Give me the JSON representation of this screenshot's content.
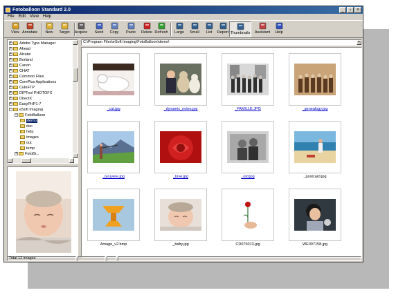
{
  "window": {
    "title": "Fotoballoon Standard 2.0"
  },
  "menu": [
    "File",
    "Edit",
    "View",
    "Help"
  ],
  "toolbar": [
    {
      "label": "View",
      "icon": "view-icon",
      "color": "#d8a020"
    },
    {
      "label": "Annotate",
      "icon": "annotate-icon",
      "color": "#c04020"
    },
    {
      "label": "New",
      "icon": "new-icon",
      "color": "#e0b030"
    },
    {
      "label": "Target",
      "icon": "target-icon",
      "color": "#e0b030"
    },
    {
      "label": "Acquire",
      "icon": "acquire-icon",
      "color": "#606060"
    },
    {
      "label": "Send",
      "icon": "send-icon",
      "color": "#4060c0"
    },
    {
      "label": "Copy",
      "icon": "copy-icon",
      "color": "#6080c0"
    },
    {
      "label": "Paste",
      "icon": "paste-icon",
      "color": "#6080c0"
    },
    {
      "label": "Delete",
      "icon": "delete-icon",
      "color": "#d02020"
    },
    {
      "label": "Refresh",
      "icon": "refresh-icon",
      "color": "#30a030"
    },
    {
      "label": "Large",
      "icon": "large-icons-icon",
      "color": "#306090"
    },
    {
      "label": "Small",
      "icon": "small-icons-icon",
      "color": "#306090"
    },
    {
      "label": "List",
      "icon": "list-icon",
      "color": "#306090"
    },
    {
      "label": "Report",
      "icon": "report-icon",
      "color": "#306090"
    },
    {
      "label": "Thumbnails",
      "icon": "thumbnails-icon",
      "color": "#306090",
      "pressed": true
    },
    {
      "label": "Assistant",
      "icon": "assistant-icon",
      "color": "#c04040"
    },
    {
      "label": "Help",
      "icon": "help-icon",
      "color": "#3050c0"
    }
  ],
  "tree": [
    {
      "label": "Adobe Type Manager",
      "level": 0,
      "expanded": false
    },
    {
      "label": "Ahead",
      "level": 0,
      "expanded": false
    },
    {
      "label": "Alcatel",
      "level": 0,
      "expanded": false
    },
    {
      "label": "Borland",
      "level": 0,
      "expanded": false
    },
    {
      "label": "Canon",
      "level": 0,
      "expanded": false
    },
    {
      "label": "CHAT",
      "level": 0,
      "expanded": false
    },
    {
      "label": "Common Files",
      "level": 0,
      "expanded": false
    },
    {
      "label": "ComPlus Applications",
      "level": 0,
      "expanded": false
    },
    {
      "label": "CuteFTP",
      "level": 0,
      "expanded": false
    },
    {
      "label": "DIPTool PHOTOFX",
      "level": 0,
      "expanded": false
    },
    {
      "label": "DirectX",
      "level": 0,
      "expanded": false
    },
    {
      "label": "EasyPHP1-7",
      "level": 0,
      "expanded": false
    },
    {
      "label": "eSoft Imaging",
      "level": 0,
      "expanded": true
    },
    {
      "label": "FotoBalloon",
      "level": 1,
      "expanded": true
    },
    {
      "label": "demo",
      "level": 2,
      "selected": true
    },
    {
      "label": "doc",
      "level": 2
    },
    {
      "label": "help",
      "level": 2
    },
    {
      "label": "images",
      "level": 2
    },
    {
      "label": "out",
      "level": 2
    },
    {
      "label": "temp",
      "level": 2
    },
    {
      "label": "FotoBi...",
      "level": 1,
      "expanded": false
    }
  ],
  "path": "C:\\Program Files\\eSoft Imaging\\FotoBalloon\\demo\\",
  "thumbnails": [
    {
      "caption": "_cat.jpg",
      "link": true,
      "scene": "cat"
    },
    {
      "caption": "_dynamic_notes.jpg",
      "link": true,
      "scene": "kids-teddies"
    },
    {
      "caption": "_FAMILLE.JPG",
      "link": true,
      "scene": "family-bw"
    },
    {
      "caption": "_genealogy.jpg",
      "link": true,
      "scene": "genealogy-sepia"
    },
    {
      "caption": "_Gruyere.jpg",
      "link": true,
      "scene": "gruyere"
    },
    {
      "caption": "_love.jpg",
      "link": true,
      "scene": "rose"
    },
    {
      "caption": "_old.jpg",
      "link": true,
      "scene": "old-couple"
    },
    {
      "caption": "_postcard.jpg",
      "link": false,
      "scene": "beach"
    },
    {
      "caption": "Amago_v2.bmp",
      "link": false,
      "scene": "3d-shape"
    },
    {
      "caption": "_baby.jpg",
      "link": false,
      "scene": "baby"
    },
    {
      "caption": "CD076013.jpg",
      "link": false,
      "scene": "rose-hand"
    },
    {
      "caption": "WE007158.jpg",
      "link": false,
      "scene": "child"
    }
  ],
  "status": {
    "count": "Total 12 images"
  }
}
